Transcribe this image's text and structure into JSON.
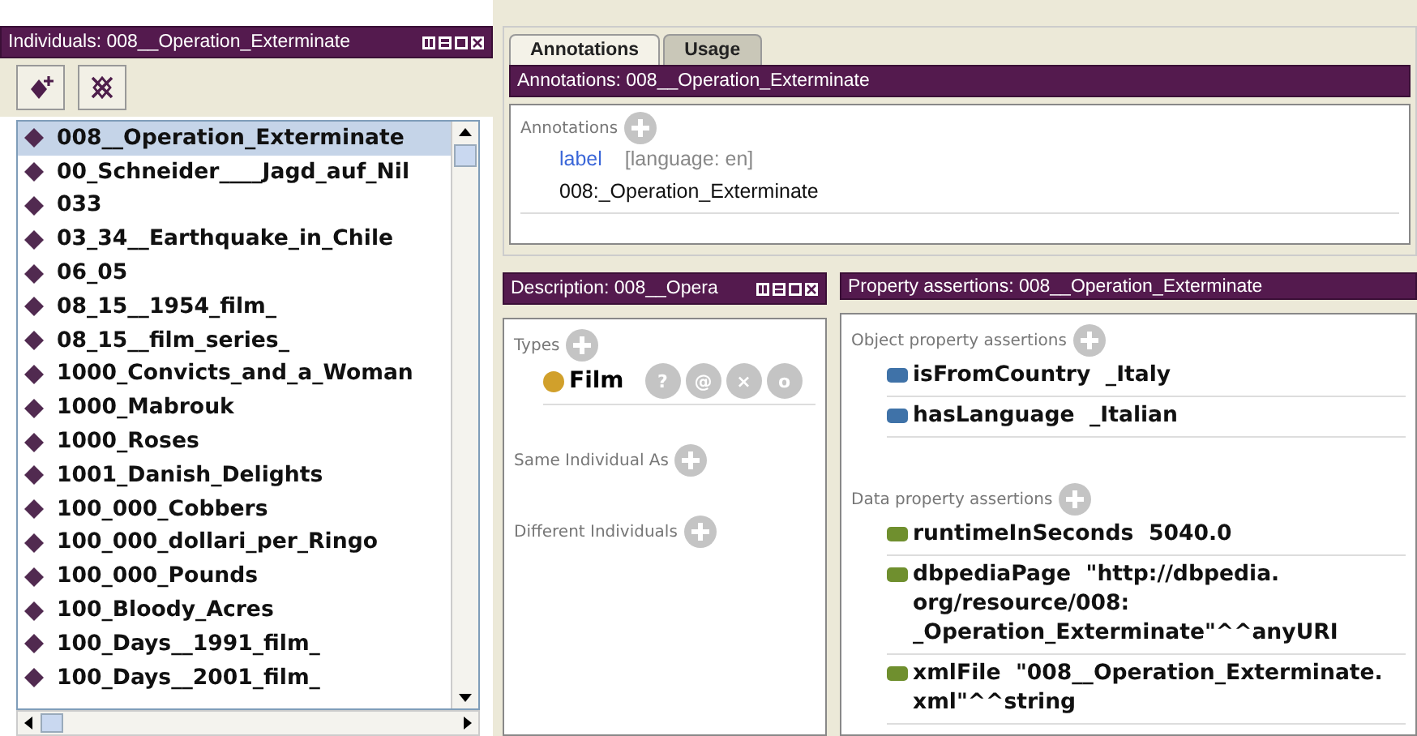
{
  "individuals_panel": {
    "title": "Individuals: 008__Operation_Exterminate",
    "items": [
      {
        "label": "008__Operation_Exterminate",
        "selected": true
      },
      {
        "label": "00_Schneider____Jagd_auf_Nil",
        "selected": false
      },
      {
        "label": "033",
        "selected": false
      },
      {
        "label": "03_34__Earthquake_in_Chile",
        "selected": false
      },
      {
        "label": "06_05",
        "selected": false
      },
      {
        "label": "08_15__1954_film_",
        "selected": false
      },
      {
        "label": "08_15__film_series_",
        "selected": false
      },
      {
        "label": "1000_Convicts_and_a_Woman",
        "selected": false
      },
      {
        "label": "1000_Mabrouk",
        "selected": false
      },
      {
        "label": "1000_Roses",
        "selected": false
      },
      {
        "label": "1001_Danish_Delights",
        "selected": false
      },
      {
        "label": "100_000_Cobbers",
        "selected": false
      },
      {
        "label": "100_000_dollari_per_Ringo",
        "selected": false
      },
      {
        "label": "100_000_Pounds",
        "selected": false
      },
      {
        "label": "100_Bloody_Acres",
        "selected": false
      },
      {
        "label": "100_Days__1991_film_",
        "selected": false
      },
      {
        "label": "100_Days__2001_film_",
        "selected": false
      }
    ]
  },
  "tabs": [
    {
      "label": "Annotations",
      "selected": true
    },
    {
      "label": "Usage",
      "selected": false
    }
  ],
  "annotations_panel": {
    "title": "Annotations: 008__Operation_Exterminate",
    "section_label": "Annotations",
    "annotations": [
      {
        "property": "label",
        "language": "[language: en]",
        "value": "008:_Operation_Exterminate"
      }
    ]
  },
  "description_panel": {
    "title": "Description: 008__Opera",
    "sections": [
      {
        "label": "Types",
        "entries": [
          {
            "label": "Film",
            "actions": [
              "?",
              "@",
              "×",
              "o"
            ]
          }
        ]
      },
      {
        "label": "Same Individual As"
      },
      {
        "label": "Different Individuals"
      }
    ]
  },
  "property_panel": {
    "title": "Property assertions: 008__Operation_Exterminate",
    "sections": [
      {
        "label": "Object property assertions",
        "kind": "object",
        "entries": [
          {
            "lines": [
              "isFromCountry  _Italy"
            ]
          },
          {
            "lines": [
              "hasLanguage  _Italian"
            ]
          }
        ]
      },
      {
        "label": "Data property assertions",
        "kind": "data",
        "entries": [
          {
            "lines": [
              "runtimeInSeconds  5040.0"
            ]
          },
          {
            "lines": [
              "dbpediaPage  \"http://dbpedia.",
              "org/resource/008:",
              "_Operation_Exterminate\"^^anyURI"
            ]
          },
          {
            "lines": [
              "xmlFile  \"008__Operation_Exterminate.",
              "xml\"^^string"
            ]
          }
        ]
      }
    ]
  }
}
